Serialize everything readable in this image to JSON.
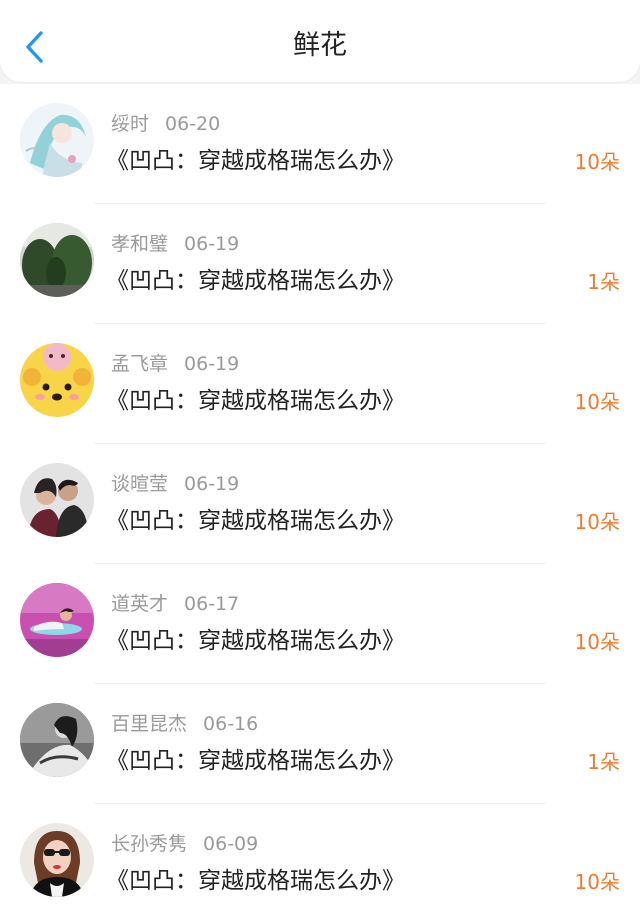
{
  "header": {
    "title": "鲜花",
    "back_icon": "chevron-left-icon",
    "accent_color": "#2196f3"
  },
  "flower_color": "#f07a30",
  "records": [
    {
      "name": "绥时",
      "date": "06-20",
      "book": "《凹凸：穿越成格瑞怎么办》",
      "count": "10朵"
    },
    {
      "name": "孝和璧",
      "date": "06-19",
      "book": "《凹凸：穿越成格瑞怎么办》",
      "count": "1朵"
    },
    {
      "name": "孟飞章",
      "date": "06-19",
      "book": "《凹凸：穿越成格瑞怎么办》",
      "count": "10朵"
    },
    {
      "name": "谈暄莹",
      "date": "06-19",
      "book": "《凹凸：穿越成格瑞怎么办》",
      "count": "10朵"
    },
    {
      "name": "道英才",
      "date": "06-17",
      "book": "《凹凸：穿越成格瑞怎么办》",
      "count": "10朵"
    },
    {
      "name": "百里昆杰",
      "date": "06-16",
      "book": "《凹凸：穿越成格瑞怎么办》",
      "count": "1朵"
    },
    {
      "name": "长孙秀隽",
      "date": "06-09",
      "book": "《凹凸：穿越成格瑞怎么办》",
      "count": "10朵"
    }
  ]
}
